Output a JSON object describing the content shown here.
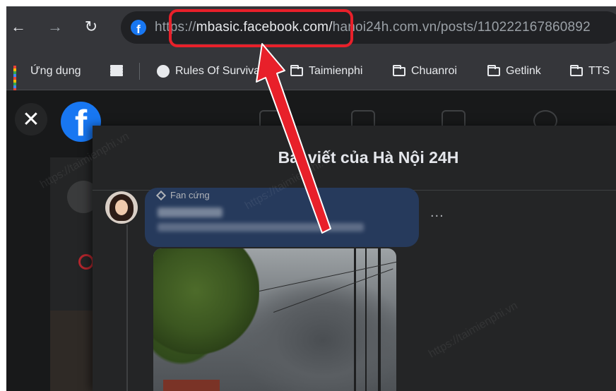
{
  "browser": {
    "url_prefix": "https://",
    "url_host": "mbasic.facebook.com/",
    "url_rest": "hanoi24h.com.vn/posts/110222167860892"
  },
  "bookmarks": [
    {
      "label": "Ứng dụng",
      "icon": "apps-grid-icon"
    },
    {
      "label": "",
      "icon": "reading-list-icon"
    },
    {
      "label": "Rules Of Surviva",
      "icon": "globe-icon"
    },
    {
      "label": "Taimienphi",
      "icon": "folder-icon"
    },
    {
      "label": "Chuanroi",
      "icon": "folder-icon"
    },
    {
      "label": "Getlink",
      "icon": "folder-icon"
    },
    {
      "label": "TTS",
      "icon": "folder-icon"
    }
  ],
  "modal": {
    "title": "Bài viết của Hà Nội 24H"
  },
  "comment": {
    "badge": "Fan cứng",
    "more": "..."
  },
  "colors": {
    "highlight": "#e8202a",
    "facebook_blue": "#1877f2"
  }
}
